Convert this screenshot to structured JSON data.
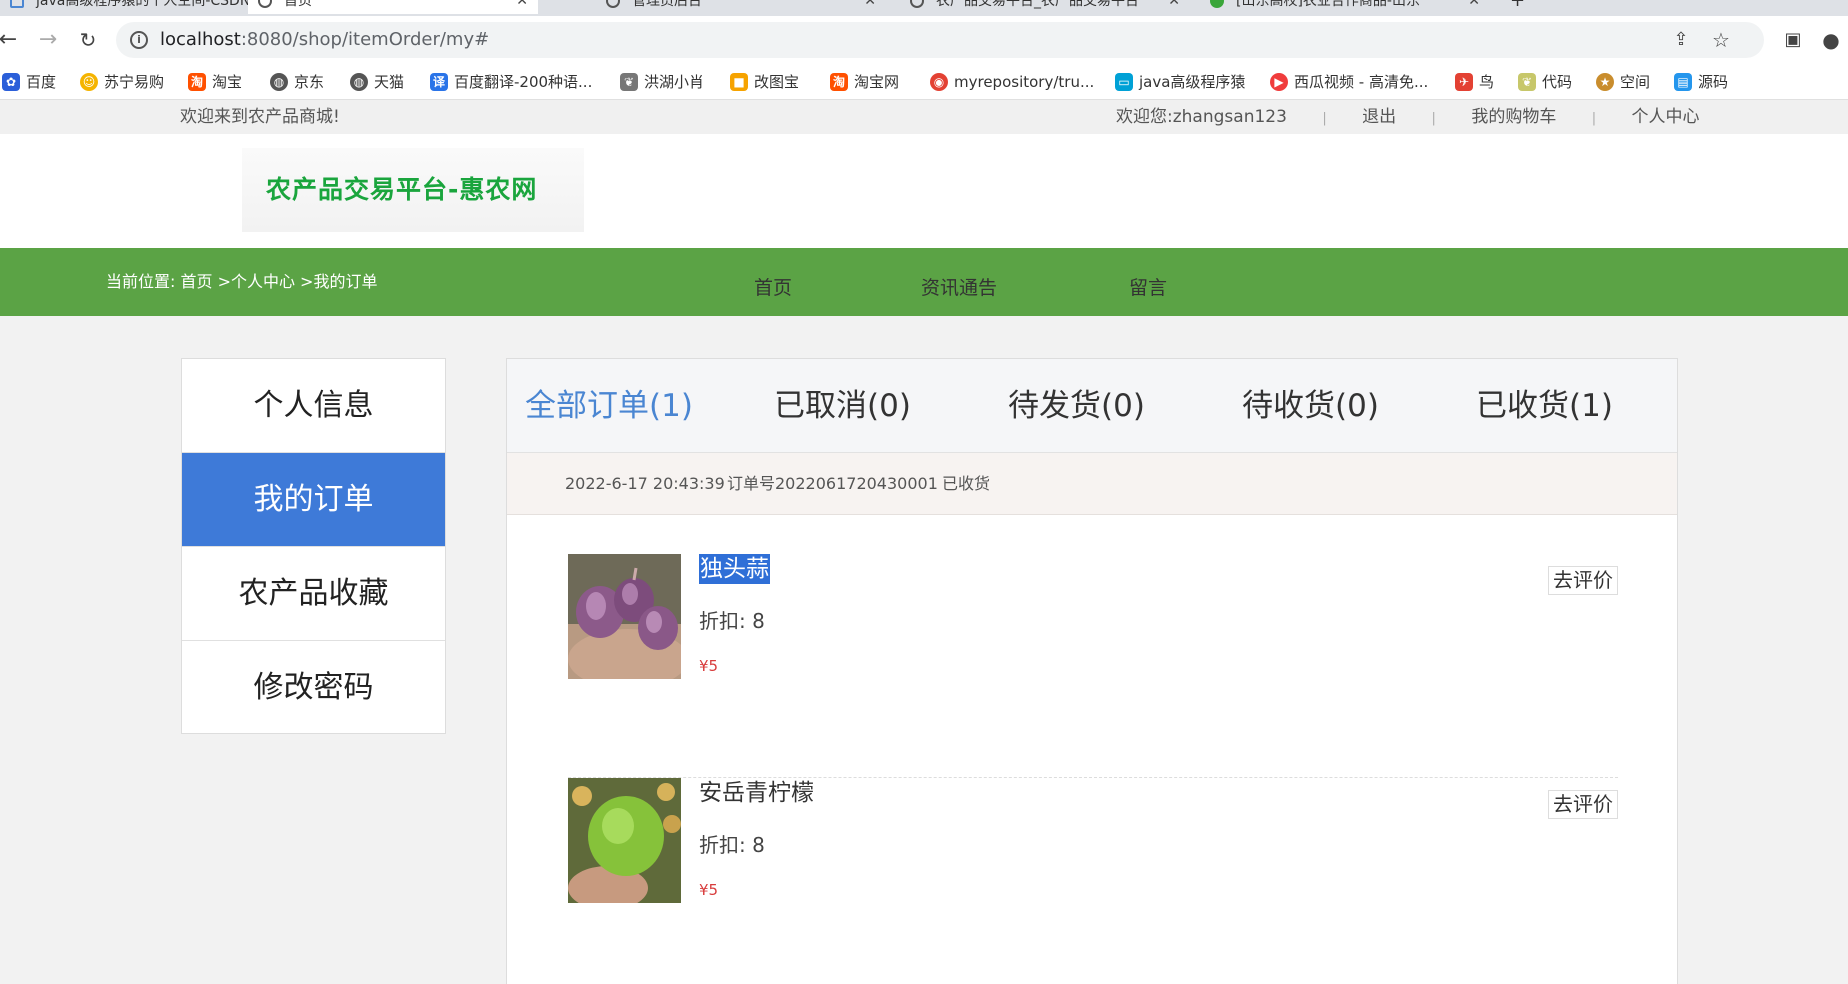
{
  "browser": {
    "tabs": [
      {
        "label": "java高级程序猿的个人空间-CSDN"
      },
      {
        "label": "首页"
      },
      {
        "label": "管理员后台"
      },
      {
        "label": "农产品交易平台_农产品交易平台"
      },
      {
        "label": "[山东高校]农业合作商品-山东"
      }
    ],
    "url_host": "localhost",
    "url_path": ":8080/shop/itemOrder/my#",
    "bookmarks": [
      {
        "label": "百度",
        "icon": "paw-icon",
        "color": "#2b5fd9"
      },
      {
        "label": "苏宁易购",
        "icon": "lion-icon",
        "color": "#f5b400"
      },
      {
        "label": "淘宝",
        "icon": "taobao-icon",
        "color": "#ff5000"
      },
      {
        "label": "京东",
        "icon": "globe-icon",
        "color": "#555555"
      },
      {
        "label": "天猫",
        "icon": "globe-icon",
        "color": "#555555"
      },
      {
        "label": "百度翻译-200种语...",
        "icon": "translate-icon",
        "color": "#2a74e8"
      },
      {
        "label": "洪湖小肖",
        "icon": "leaf-icon",
        "color": "#777777"
      },
      {
        "label": "改图宝",
        "icon": "image-icon",
        "color": "#f6a300"
      },
      {
        "label": "淘宝网",
        "icon": "taobao-icon",
        "color": "#ff5000"
      },
      {
        "label": "myrepository/tru...",
        "icon": "chrome-icon",
        "color": "#e34133"
      },
      {
        "label": "java高级程序猿",
        "icon": "tv-icon",
        "color": "#00a1d6"
      },
      {
        "label": "西瓜视频 - 高清免...",
        "icon": "play-icon",
        "color": "#f03c3c"
      },
      {
        "label": "鸟",
        "icon": "bird-icon",
        "color": "#e34133"
      },
      {
        "label": "代码",
        "icon": "leaf-icon",
        "color": "#c7c76a"
      },
      {
        "label": "空间",
        "icon": "qzone-icon",
        "color": "#c98d2d"
      },
      {
        "label": "源码",
        "icon": "docker-icon",
        "color": "#2496ed"
      }
    ]
  },
  "site": {
    "welcome": "欢迎来到农产品商城!",
    "user_greeting": "欢迎您:",
    "username": "zhangsan123",
    "logout": "退出",
    "cart": "我的购物车",
    "center": "个人中心",
    "logo": "农产品交易平台-惠农网",
    "breadcrumb": "当前位置: 首页 >个人中心 >我的订单",
    "menu": [
      "首页",
      "资讯通告",
      "留言"
    ]
  },
  "sidebar": {
    "items": [
      "个人信息",
      "我的订单",
      "农产品收藏",
      "修改密码"
    ]
  },
  "order_tabs": [
    "全部订单(1)",
    "已取消(0)",
    "待发货(0)",
    "待收货(0)",
    "已收货(1)"
  ],
  "order": {
    "time": "2022-6-17 20:43:39",
    "number": "订单号2022061720430001",
    "status": "已收货",
    "items": [
      {
        "name": "独头蒜",
        "discount": "折扣: 8",
        "price": "¥5",
        "action": "去评价"
      },
      {
        "name": "安岳青柠檬",
        "discount": "折扣: 8",
        "price": "¥5",
        "action": "去评价"
      }
    ]
  }
}
